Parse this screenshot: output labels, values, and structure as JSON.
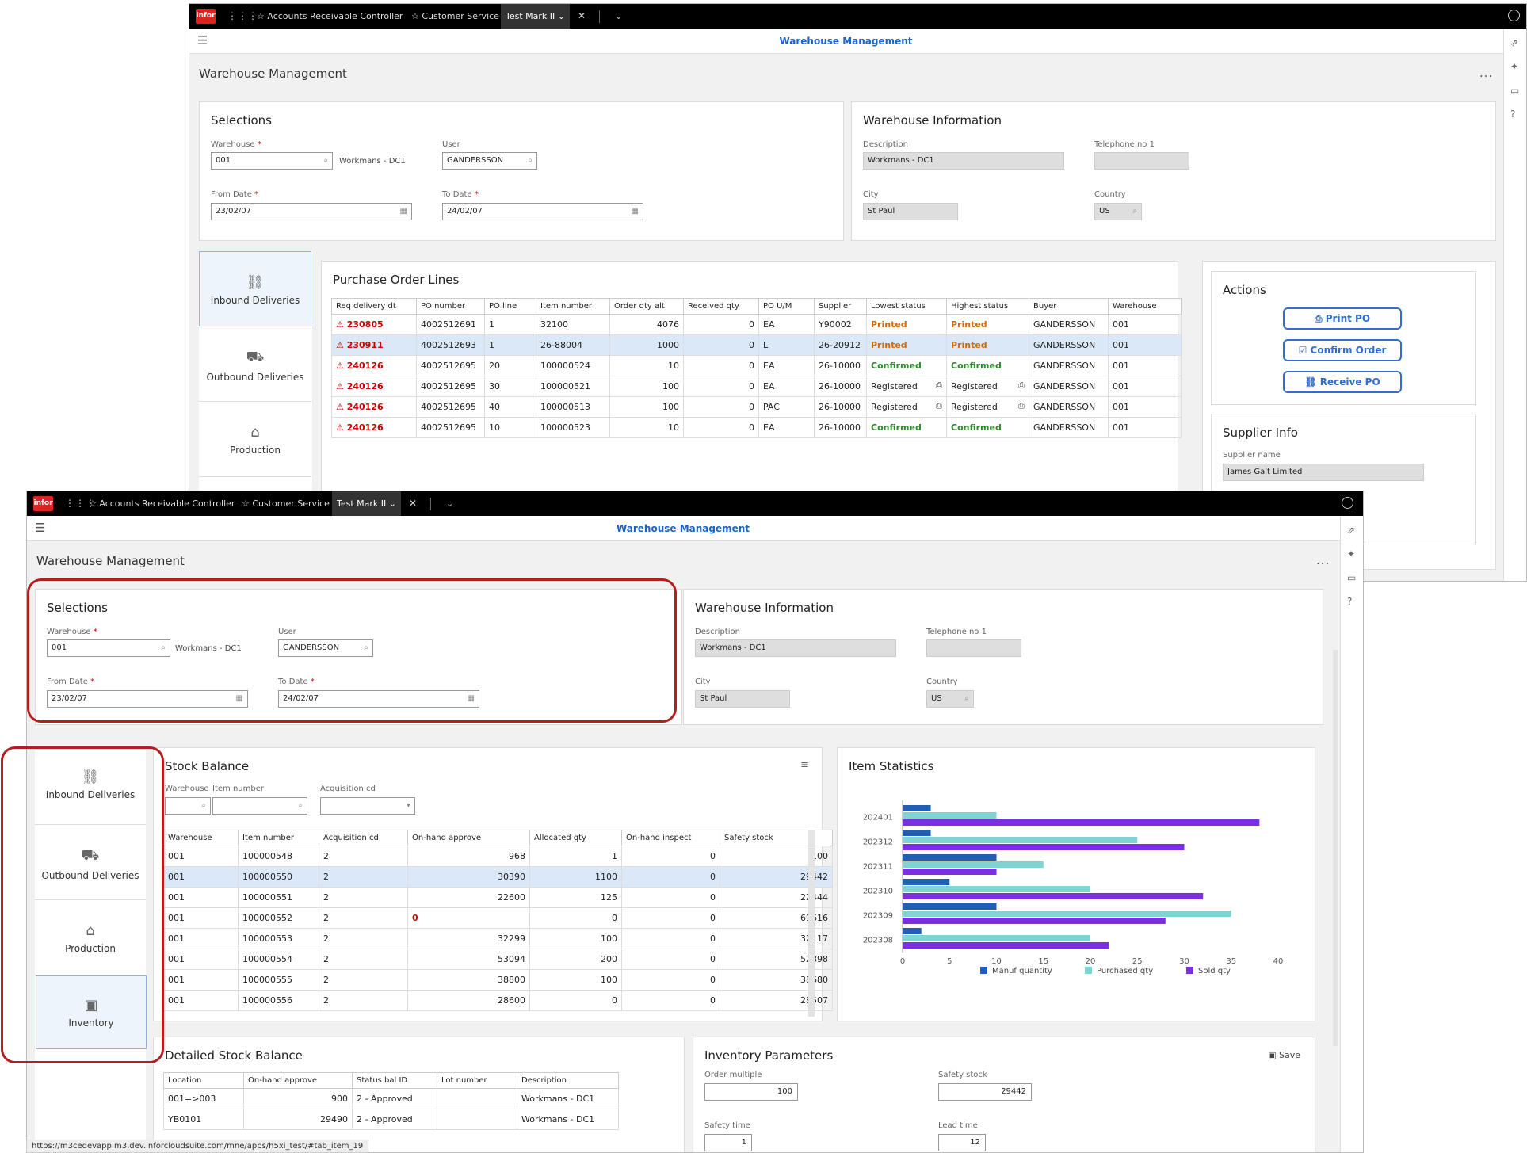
{
  "shell": {
    "tabs": [
      "Accounts Receivable Controller",
      "Customer Service"
    ],
    "active_tab": "Test Mark II",
    "app_title": "Warehouse Management",
    "logo": "infor",
    "page_title": "Warehouse Management",
    "more": "...",
    "status_url": "https://m3cedevapp.m3.dev.inforcloudsuite.com/mne/apps/h5xi_test/#tab_item_19"
  },
  "selections": {
    "title": "Selections",
    "warehouse_label": "Warehouse",
    "warehouse_value": "001",
    "warehouse_desc": "Workmans - DC1",
    "user_label": "User",
    "user_value": "GANDERSSON",
    "from_date_label": "From Date",
    "from_date_value": "23/02/07",
    "to_date_label": "To Date",
    "to_date_value": "24/02/07",
    "required_mark": "*"
  },
  "warehouse_info": {
    "title": "Warehouse Information",
    "description_label": "Description",
    "description_value": "Workmans - DC1",
    "telephone_label": "Telephone no 1",
    "telephone_value": "",
    "city_label": "City",
    "city_value": "St Paul",
    "country_label": "Country",
    "country_value": "US"
  },
  "nav": {
    "inbound": "Inbound Deliveries",
    "outbound": "Outbound Deliveries",
    "production": "Production",
    "inventory": "Inventory"
  },
  "po_lines": {
    "title": "Purchase Order Lines",
    "columns": [
      "Req delivery dt",
      "PO number",
      "PO line",
      "Item number",
      "Order qty alt",
      "Received qty",
      "PO U/M",
      "Supplier",
      "Lowest status",
      "Highest status",
      "Buyer",
      "Warehouse"
    ],
    "rows": [
      [
        "230805",
        "4002512691",
        "1",
        "32100",
        "4076",
        "0",
        "EA",
        "Y90002",
        "Printed",
        "Printed",
        "GANDERSSON",
        "001"
      ],
      [
        "230911",
        "4002512693",
        "1",
        "26-88004",
        "1000",
        "0",
        "L",
        "26-20912",
        "Printed",
        "Printed",
        "GANDERSSON",
        "001"
      ],
      [
        "240126",
        "4002512695",
        "20",
        "100000524",
        "10",
        "0",
        "EA",
        "26-10000",
        "Confirmed",
        "Confirmed",
        "GANDERSSON",
        "001"
      ],
      [
        "240126",
        "4002512695",
        "30",
        "100000521",
        "100",
        "0",
        "EA",
        "26-10000",
        "Registered",
        "Registered",
        "GANDERSSON",
        "001"
      ],
      [
        "240126",
        "4002512695",
        "40",
        "100000513",
        "100",
        "0",
        "PAC",
        "26-10000",
        "Registered",
        "Registered",
        "GANDERSSON",
        "001"
      ],
      [
        "240126",
        "4002512695",
        "10",
        "100000523",
        "10",
        "0",
        "EA",
        "26-10000",
        "Confirmed",
        "Confirmed",
        "GANDERSSON",
        "001"
      ]
    ]
  },
  "actions": {
    "title": "Actions",
    "print_po": "Print PO",
    "confirm_order": "Confirm Order",
    "receive_po": "Receive PO"
  },
  "supplier_info": {
    "title": "Supplier Info",
    "name_label": "Supplier name",
    "name_value": "James Galt Limited"
  },
  "stock_balance": {
    "title": "Stock Balance",
    "filter_warehouse": "Warehouse",
    "filter_item": "Item number",
    "filter_acq": "Acquisition cd",
    "columns": [
      "Warehouse",
      "Item number",
      "Acquisition cd",
      "On-hand approve",
      "Allocated qty",
      "On-hand inspect",
      "Safety stock"
    ],
    "rows": [
      [
        "001",
        "100000548",
        "2",
        "968",
        "1",
        "0",
        "100"
      ],
      [
        "001",
        "100000550",
        "2",
        "30390",
        "1100",
        "0",
        "29442"
      ],
      [
        "001",
        "100000551",
        "2",
        "22600",
        "125",
        "0",
        "22444"
      ],
      [
        "001",
        "100000552",
        "2",
        "0",
        "0",
        "0",
        "69616"
      ],
      [
        "001",
        "100000553",
        "2",
        "32299",
        "100",
        "0",
        "32117"
      ],
      [
        "001",
        "100000554",
        "2",
        "53094",
        "200",
        "0",
        "52898"
      ],
      [
        "001",
        "100000555",
        "2",
        "38800",
        "100",
        "0",
        "38680"
      ],
      [
        "001",
        "100000556",
        "2",
        "28600",
        "0",
        "0",
        "28507"
      ]
    ]
  },
  "item_statistics": {
    "title": "Item Statistics"
  },
  "chart_data": {
    "type": "bar",
    "orientation": "horizontal",
    "categories": [
      "202401",
      "202312",
      "202311",
      "202310",
      "202309",
      "202308"
    ],
    "series": [
      {
        "name": "Manuf quantity",
        "values": [
          3,
          3,
          10,
          5,
          10,
          2
        ],
        "color": "#1f5fb5"
      },
      {
        "name": "Purchased qty",
        "values": [
          10,
          25,
          15,
          20,
          35,
          20
        ],
        "color": "#7fd3d3"
      },
      {
        "name": "Sold qty",
        "values": [
          38,
          30,
          10,
          32,
          28,
          22
        ],
        "color": "#7b2fe0"
      }
    ],
    "xlim": [
      0,
      40
    ],
    "xticks": [
      "0",
      "5",
      "10",
      "15",
      "20",
      "25",
      "30",
      "35",
      "40"
    ],
    "legend": "bottom",
    "grid": false
  },
  "detailed_stock": {
    "title": "Detailed Stock Balance",
    "columns": [
      "Location",
      "On-hand approve",
      "Status bal ID",
      "Lot number",
      "Description"
    ],
    "rows": [
      [
        "001=>003",
        "900",
        "2 - Approved",
        "",
        "Workmans - DC1"
      ],
      [
        "YB0101",
        "29490",
        "2 - Approved",
        "",
        "Workmans - DC1"
      ]
    ]
  },
  "inventory_params": {
    "title": "Inventory Parameters",
    "save": "Save",
    "order_multiple_label": "Order multiple",
    "order_multiple_value": "100",
    "safety_stock_label": "Safety stock",
    "safety_stock_value": "29442",
    "safety_time_label": "Safety time",
    "safety_time_value": "1",
    "lead_time_label": "Lead time",
    "lead_time_value": "12"
  }
}
